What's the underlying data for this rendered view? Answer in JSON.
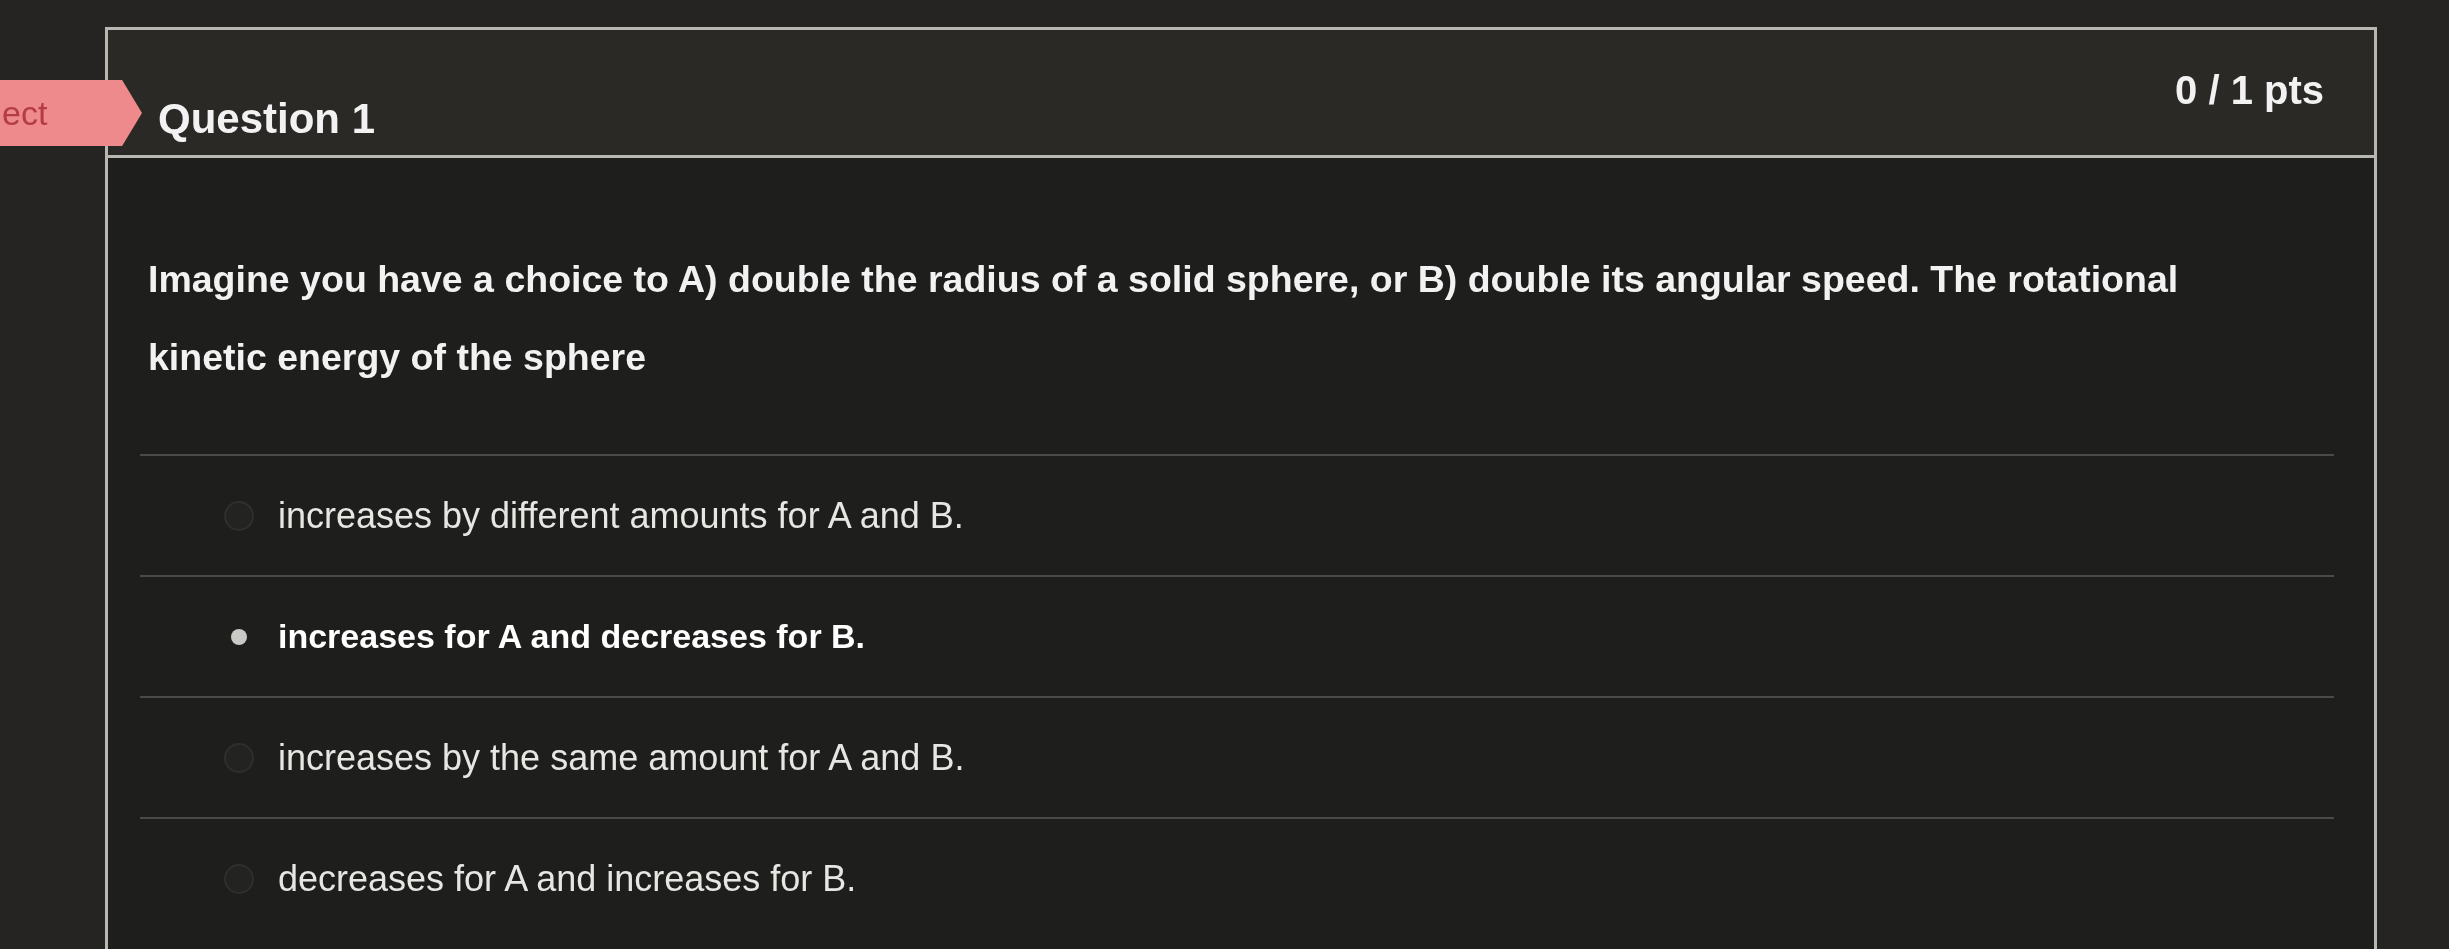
{
  "result_tag": {
    "text": "ect"
  },
  "question": {
    "title": "Question 1",
    "points": "0 / 1 pts",
    "text": "Imagine you have a choice to A) double the radius of a solid sphere, or B) double its angular speed. The rotational kinetic energy of the sphere"
  },
  "answers": [
    {
      "text": "increases by different amounts for A and B.",
      "selected": false
    },
    {
      "text": "increases for A and decreases for B.",
      "selected": true
    },
    {
      "text": "increases by the same amount for A and B.",
      "selected": false
    },
    {
      "text": "decreases for A and increases for B.",
      "selected": false
    }
  ]
}
